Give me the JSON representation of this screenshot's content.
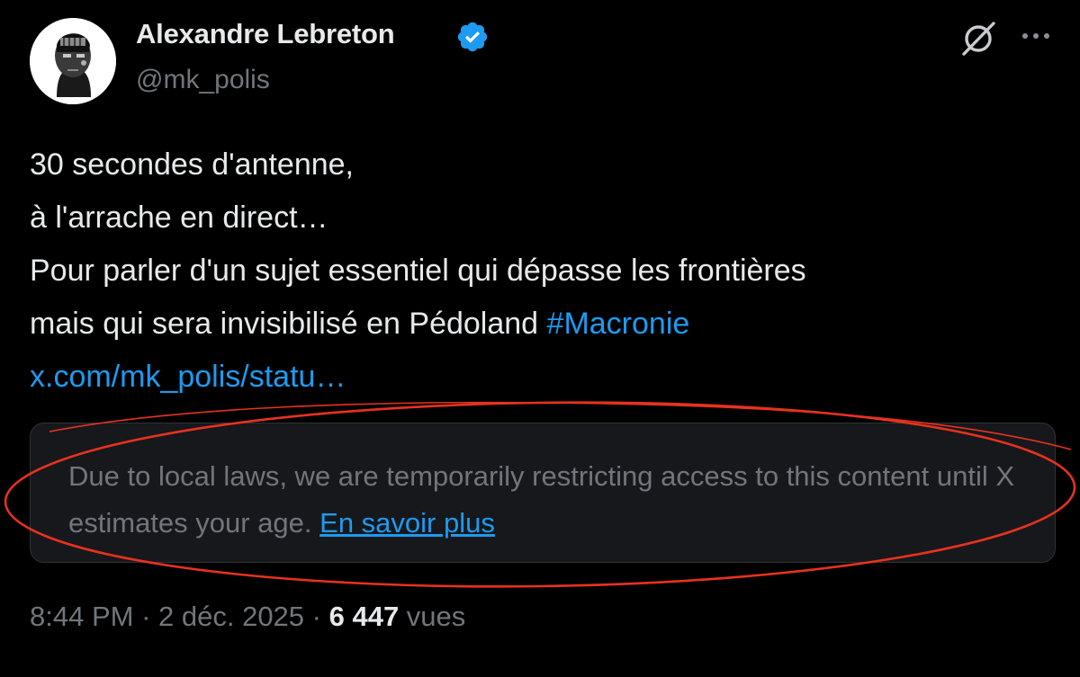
{
  "author": {
    "name": "Alexandre Lebreton",
    "handle": "@mk_polis",
    "verified": true
  },
  "header_icons": {
    "grok": "grok-icon",
    "more": "more-horizontal-icon"
  },
  "tweet": {
    "lines": [
      "30 secondes d'antenne,",
      "à l'arrache en direct…",
      "Pour parler d'un sujet essentiel qui dépasse les frontières"
    ],
    "line4_text": "mais qui sera invisibilisé en Pédoland ",
    "hashtag": "#Macronie",
    "link": "x.com/mk_polis/statu…"
  },
  "notice": {
    "text": "Due to local laws, we are temporarily restricting access to this content until X estimates your age.",
    "link_label": "En savoir plus"
  },
  "meta": {
    "time": "8:44 PM",
    "separator": " · ",
    "date": "2 déc. 2025",
    "views_count": "6 447",
    "views_label": " vues"
  },
  "colors": {
    "background": "#000000",
    "text": "#e7e9ea",
    "secondary": "#71767b",
    "link": "#1d9bf0",
    "notice_bg": "#16181c",
    "annotation": "#e8321e"
  }
}
